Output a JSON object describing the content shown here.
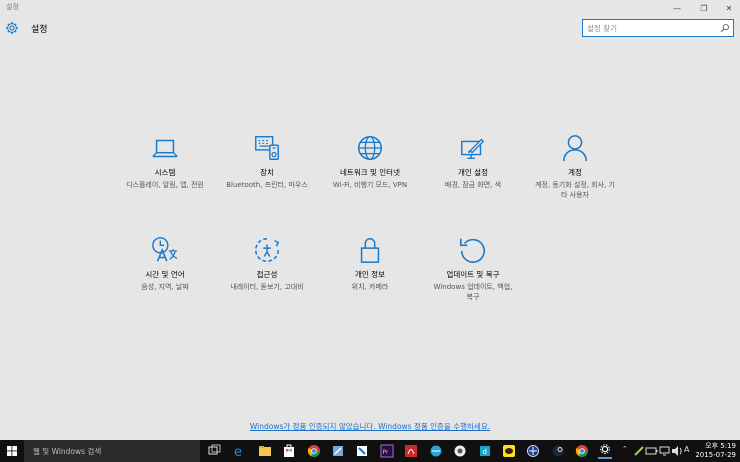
{
  "window": {
    "title": "설정",
    "minimize_glyph": "—",
    "maximize_glyph": "❐",
    "close_glyph": "✕"
  },
  "header": {
    "title": "설정",
    "icon": "gear-icon"
  },
  "search": {
    "placeholder": "설정 찾기",
    "icon": "search-icon"
  },
  "accent_color": "#1979ca",
  "tiles": [
    {
      "label": "시스템",
      "description": "디스플레이, 알림, 앱, 전원",
      "icon": "laptop-icon"
    },
    {
      "label": "장치",
      "description": "Bluetooth, 프린터, 마우스",
      "icon": "keyboard-icon"
    },
    {
      "label": "네트워크 및 인터넷",
      "description": "Wi-Fi, 비행기 모드, VPN",
      "icon": "globe-icon"
    },
    {
      "label": "개인 설정",
      "description": "배경, 잠금 화면, 색",
      "icon": "paint-monitor-icon"
    },
    {
      "label": "계정",
      "description": "계정, 동기화 설정, 회사, 기타 사용자",
      "icon": "person-icon"
    },
    {
      "label": "시간 및 언어",
      "description": "음성, 지역, 날짜",
      "icon": "time-language-icon"
    },
    {
      "label": "접근성",
      "description": "내레이터, 돋보기, 고대비",
      "icon": "ease-of-access-icon"
    },
    {
      "label": "개인 정보",
      "description": "위치, 카메라",
      "icon": "lock-icon"
    },
    {
      "label": "업데이트 및 복구",
      "description": "Windows 업데이트, 백업, 복구",
      "icon": "refresh-icon"
    }
  ],
  "activation_text": "Windows가 정품 인증되지 않았습니다. Windows 정품 인증을 수행하세요.",
  "taskbar": {
    "search_placeholder": "웹 및 Windows 검색",
    "clock_time": "오후 5:19",
    "clock_date": "2015-07-29",
    "input_indicator": "A"
  }
}
